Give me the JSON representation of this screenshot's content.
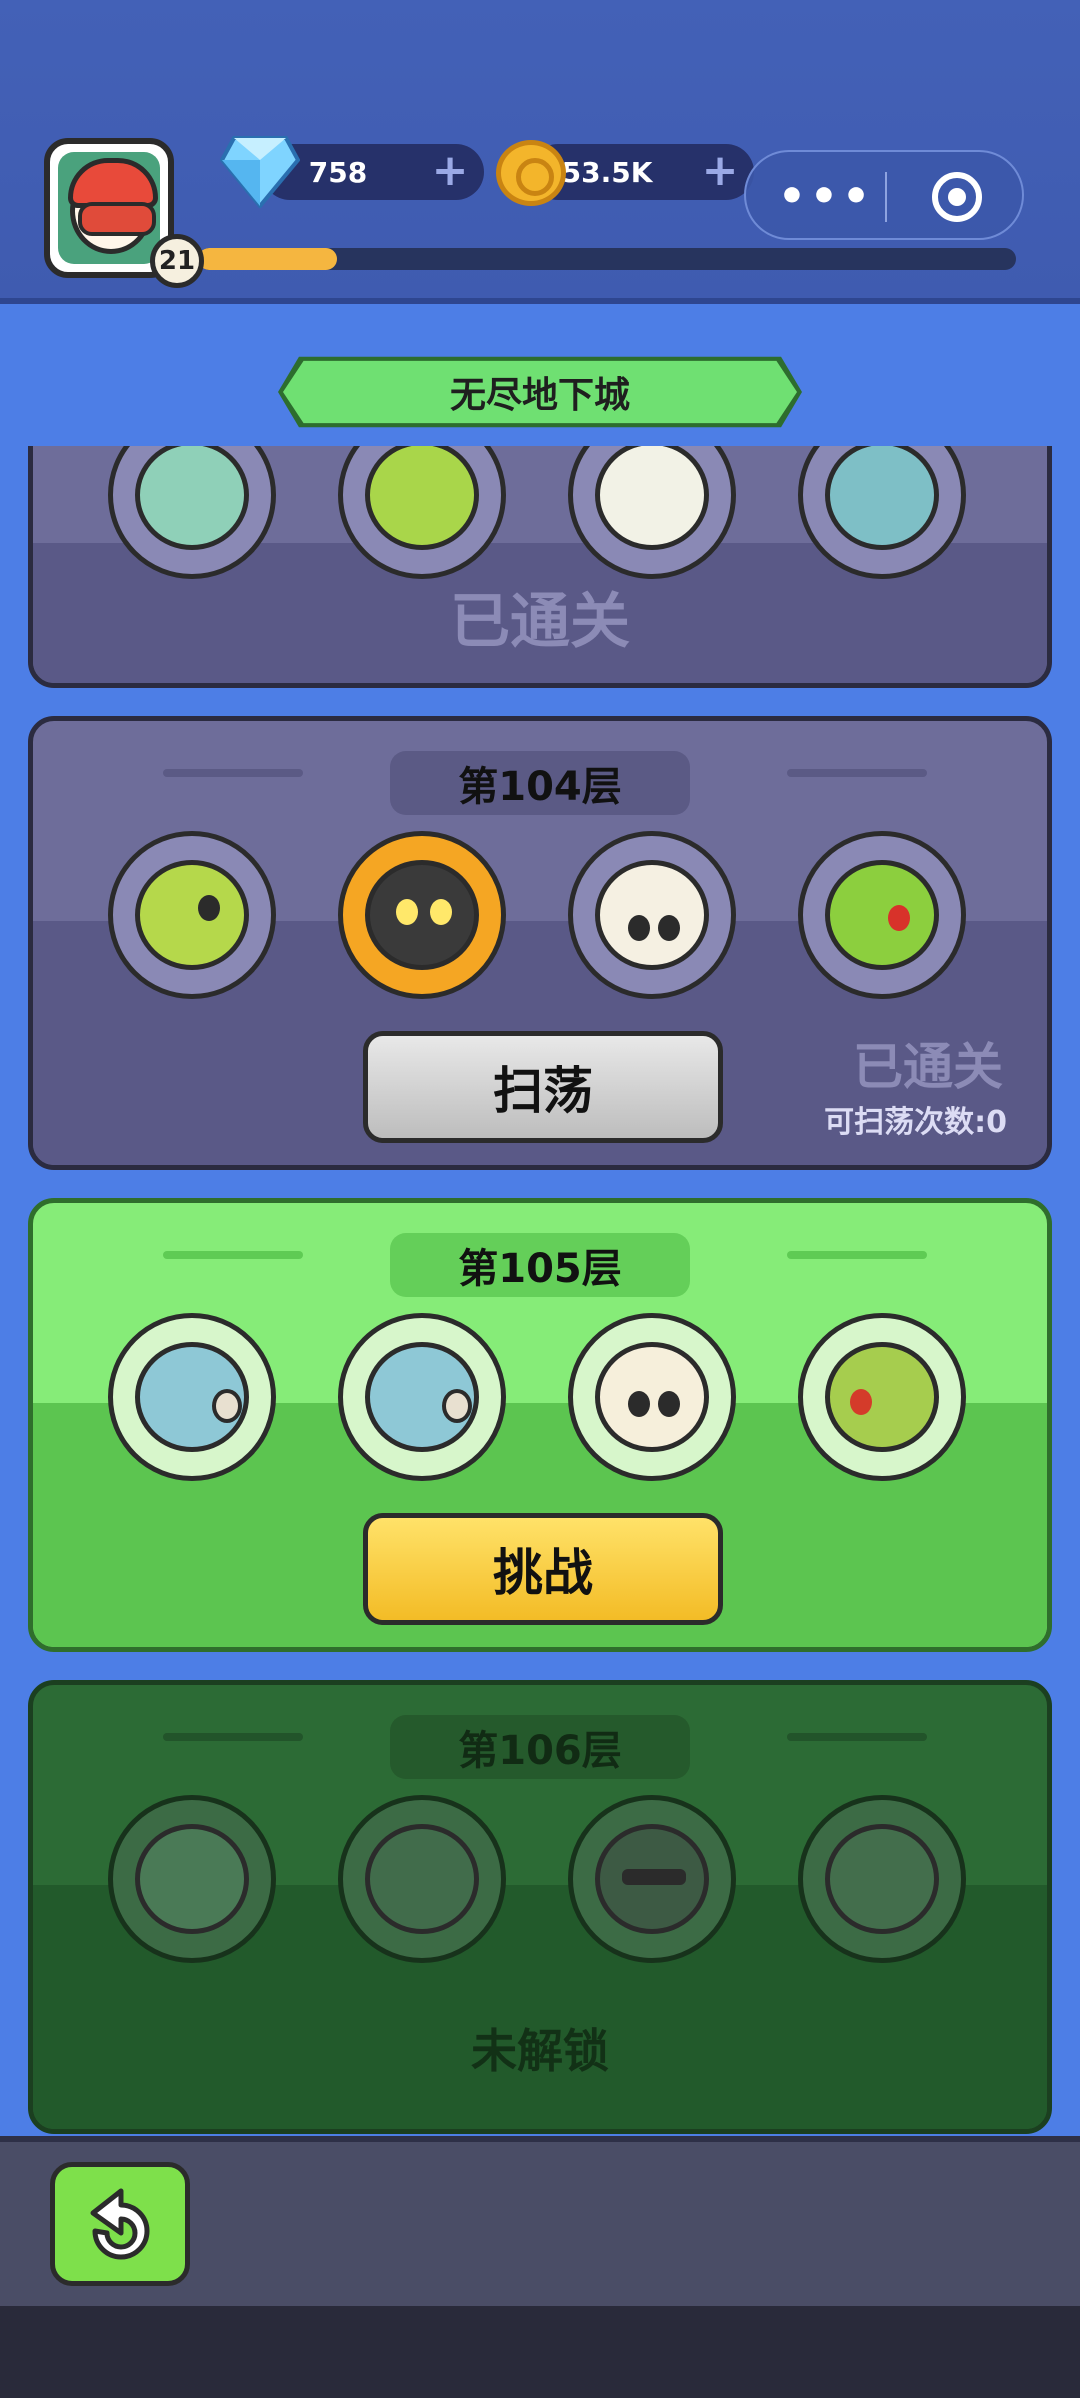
{
  "header": {
    "level": "21",
    "xp_fraction": 0.17,
    "gems": "758",
    "coins": "53.5K",
    "gem_icon": "diamond-icon",
    "coin_icon": "coin-icon",
    "more_icon": "more-dots-icon",
    "close_icon": "target-close-icon"
  },
  "title": "无尽地下城",
  "floors": [
    {
      "label": "",
      "status": "已通关"
    },
    {
      "label": "第104层",
      "button": "扫荡",
      "status": "已通关",
      "sweep": "可扫荡次数:0"
    },
    {
      "label": "第105层",
      "button": "挑战"
    },
    {
      "label": "第106层",
      "status": "未解锁"
    }
  ],
  "footer": {
    "back_icon": "back-arrow-icon"
  },
  "colors": {
    "accent_green": "#5ad45c",
    "button_yellow": "#f3bc26",
    "panel_done": "#6e6d9a",
    "panel_locked": "#2c6b35"
  }
}
